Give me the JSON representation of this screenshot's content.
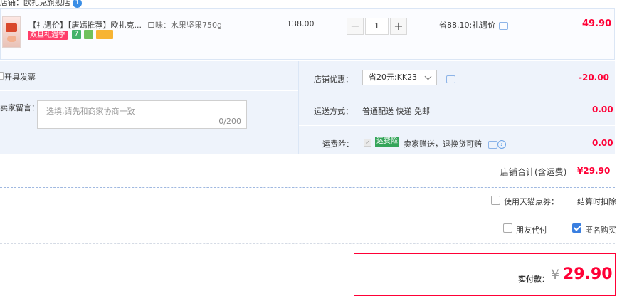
{
  "store": {
    "name": "店铺：欧扎克旗舰店",
    "badge": "1"
  },
  "item": {
    "title": "【礼遇价】【唐嫣推荐】欧扎克...",
    "flavor": "口味：水果坚果750g",
    "promo_tag": "双旦礼遇季",
    "tag_7": "7",
    "unit_price": "138.00",
    "quantity": "1",
    "minus": "−",
    "plus": "+",
    "saving": "省88.10:礼遇价",
    "subtotal": "49.90"
  },
  "extras": {
    "invoice": "开具发票",
    "note_label": "卖家留言：",
    "note_placeholder": "选填,请先和商家协商一致",
    "note_count": "0/200"
  },
  "shop_promo": {
    "label": "店铺优惠：",
    "selected": "省20元:KK23",
    "value": "-20.00"
  },
  "shipping": {
    "label": "运送方式：",
    "method": "普通配送 快递 免邮",
    "value": "0.00"
  },
  "insurance": {
    "label": "运费险：",
    "badge": "运费险",
    "text": "卖家赠送，退换货可赔",
    "help": "?",
    "value": "0.00"
  },
  "store_total": {
    "label": "店铺合计(含运费)",
    "value": "¥29.90"
  },
  "coupon": {
    "label": "使用天猫点券：",
    "right": "结算时扣除"
  },
  "options": {
    "friend_pay": {
      "label": "朋友代付",
      "checked": false
    },
    "anonymous": {
      "label": "匿名购买",
      "checked": true
    }
  },
  "payment": {
    "label": "实付款：",
    "currency": "¥",
    "amount": "29.90"
  },
  "colors": {
    "accent_red": "#ff0036",
    "accent_blue": "#3a7fe0",
    "band_bg": "#eef3fb"
  }
}
